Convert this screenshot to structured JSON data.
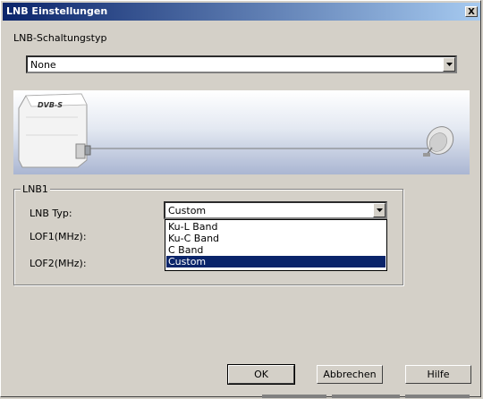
{
  "window": {
    "title": "LNB Einstellungen",
    "close_label": "X"
  },
  "switch_type": {
    "label": "LNB-Schaltungstyp",
    "value": "None"
  },
  "banner": {
    "device_label": "DVB-S"
  },
  "lnb1": {
    "group_label": "LNB1",
    "type_label": "LNB Typ:",
    "type_value": "Custom",
    "lof1_label": "LOF1(MHz):",
    "lof2_label": "LOF2(MHz):",
    "options": [
      "Ku-L Band",
      "Ku-C Band",
      "C Band",
      "Custom"
    ],
    "selected_option": "Custom"
  },
  "buttons": {
    "ok": "OK",
    "cancel": "Abbrechen",
    "help": "Hilfe"
  },
  "colors": {
    "titlebar_start": "#0a246a",
    "titlebar_end": "#a6caf0",
    "selection": "#0a246a",
    "dialog_bg": "#d4d0c8"
  }
}
